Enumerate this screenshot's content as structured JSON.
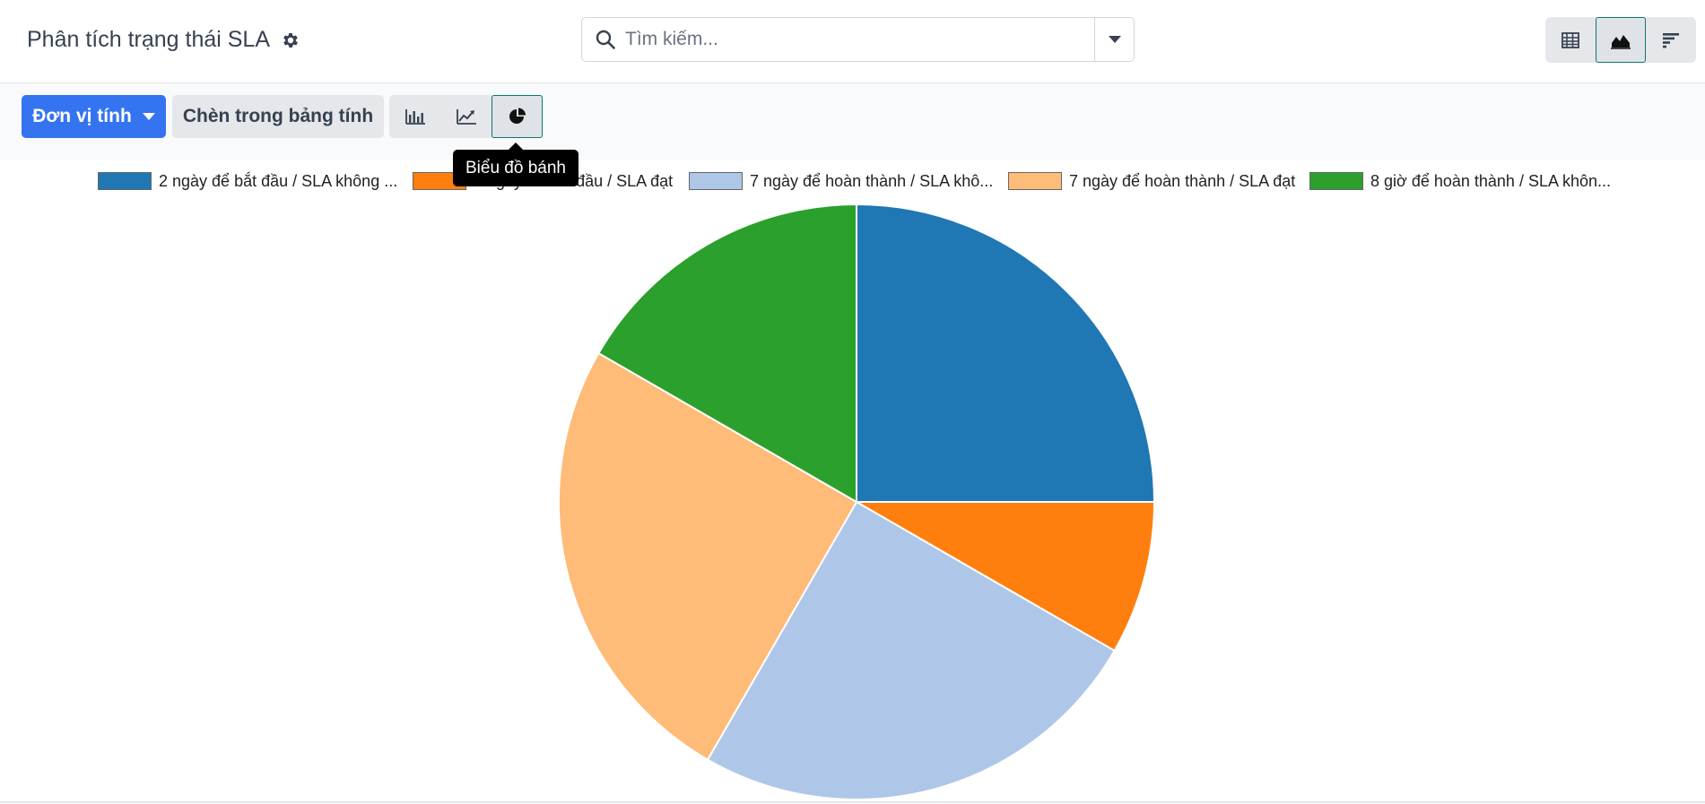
{
  "header": {
    "title": "Phân tích trạng thái SLA",
    "search_placeholder": "Tìm kiếm..."
  },
  "toolbar": {
    "measure_label": "Đơn vị tính",
    "insert_label": "Chèn trong bảng tính",
    "tooltip": "Biểu đồ bánh"
  },
  "icons": {
    "settings": "gear-icon",
    "search": "search-icon",
    "views": [
      "pivot-table-icon",
      "graph-view-icon",
      "cohort-view-icon"
    ],
    "charts": [
      "bar-chart-icon",
      "line-chart-icon",
      "pie-chart-icon"
    ]
  },
  "colors": {
    "primary": "#3574f0",
    "active_border": "#0f766e"
  },
  "chart_data": {
    "type": "pie",
    "series": [
      {
        "name": "2 ngày để bắt đầu / SLA không ...",
        "value": 25,
        "color": "#1f77b4"
      },
      {
        "name": "2 ngày để bắt đầu / SLA đạt",
        "value": 8.33,
        "color": "#ff7f0e"
      },
      {
        "name": "7 ngày để hoàn thành / SLA khô...",
        "value": 25,
        "color": "#aec7e8"
      },
      {
        "name": "7 ngày để hoàn thành / SLA đạt",
        "value": 25,
        "color": "#ffbb78"
      },
      {
        "name": "8 giờ để hoàn thành / SLA khôn...",
        "value": 16.67,
        "color": "#2ca02c"
      }
    ],
    "legend_position": "top"
  }
}
